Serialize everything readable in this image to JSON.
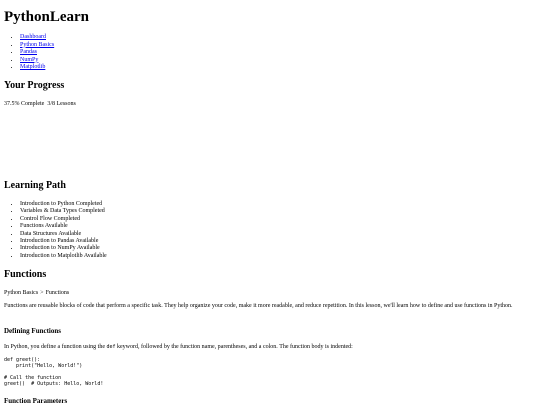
{
  "site": {
    "title": "PythonLearn"
  },
  "nav": {
    "items": [
      {
        "label": "Dashboard"
      },
      {
        "label": "Python Basics"
      },
      {
        "label": "Pandas"
      },
      {
        "label": "NumPy"
      },
      {
        "label": "Matplotlib"
      }
    ]
  },
  "progress": {
    "heading": "Your Progress",
    "percent_text": "37.5% Complete",
    "lessons_text": "3/8 Lessons",
    "fraction": 0.375
  },
  "learning_path": {
    "heading": "Learning Path",
    "items": [
      {
        "label": "Introduction to Python Completed"
      },
      {
        "label": "Variables & Data Types Completed"
      },
      {
        "label": "Control Flow Completed"
      },
      {
        "label": "Functions Available"
      },
      {
        "label": "Data Structures Available"
      },
      {
        "label": "Introduction to Pandas Available"
      },
      {
        "label": "Introduction to NumPy Available"
      },
      {
        "label": "Introduction to Matplotlib Available"
      }
    ]
  },
  "lesson": {
    "title": "Functions",
    "breadcrumb": {
      "parent": "Python Basics",
      "separator": ">",
      "current": "Functions"
    },
    "intro": "Functions are reusable blocks of code that perform a specific task. They help organize your code, make it more readable, and reduce repetition. In this lesson, we'll learn how to define and use functions in Python.",
    "defining": {
      "heading": "Defining Functions",
      "text_before": "In Python, you define a function using the ",
      "keyword": "def",
      "text_after": " keyword, followed by the function name, parentheses, and a colon. The function body is indented:",
      "code": "def greet():\n    print(\"Hello, World!\")\n\n# Call the function\ngreet()  # Outputs: Hello, World!"
    },
    "parameters": {
      "heading": "Function Parameters"
    }
  }
}
